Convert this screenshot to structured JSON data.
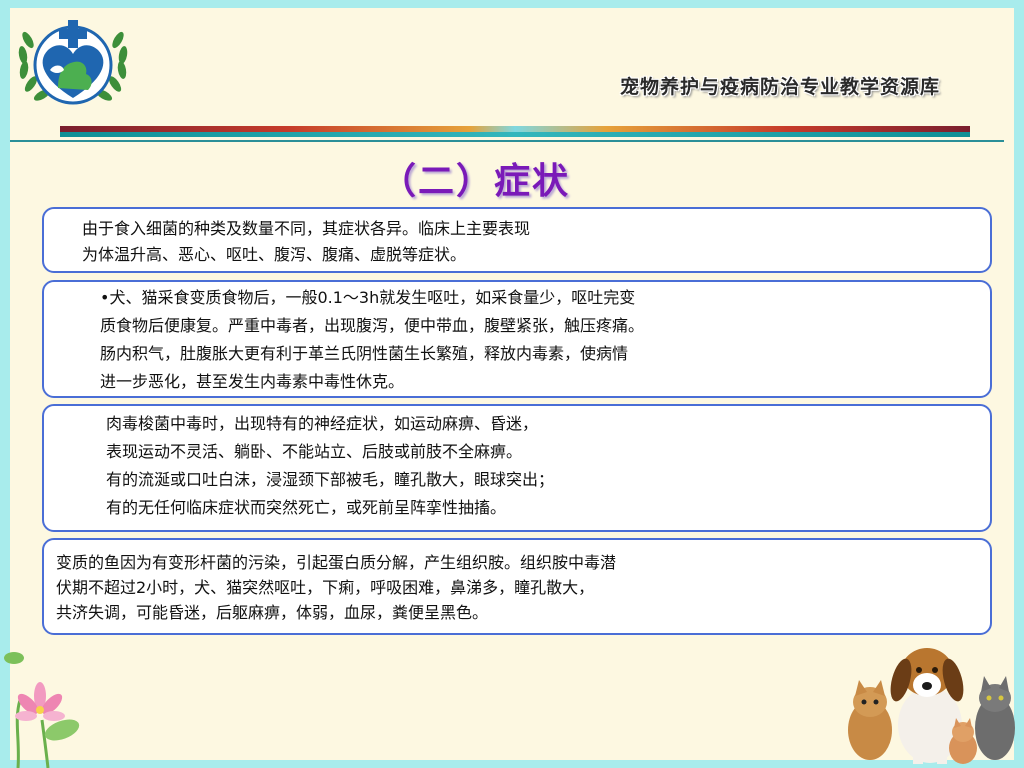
{
  "header": {
    "resource_title": "宠物养护与疫病防治专业教学资源库"
  },
  "slide": {
    "title": "（二）症状",
    "boxes": [
      {
        "lines": [
          "由于食入细菌的种类及数量不同，其症状各异。临床上主要表现",
          "为体温升高、恶心、呕吐、腹泻、腹痛、虚脱等症状。"
        ]
      },
      {
        "lines": [
          "•犬、猫采食变质食物后，一般0.1～3h就发生呕吐，如采食量少，呕吐完变",
          "质食物后便康复。严重中毒者，出现腹泻，便中带血，腹壁紧张，触压疼痛。",
          "肠内积气，肚腹胀大更有利于革兰氏阴性菌生长繁殖，释放内毒素，使病情",
          "进一步恶化，甚至发生内毒素中毒性休克。"
        ]
      },
      {
        "lines": [
          "肉毒梭菌中毒时，出现特有的神经症状，如运动麻痹、昏迷，",
          "表现运动不灵活、躺卧、不能站立、后肢或前肢不全麻痹。",
          "有的流涎或口吐白沫，浸湿颈下部被毛，瞳孔散大，眼球突出；",
          "有的无任何临床症状而突然死亡，或死前呈阵挛性抽搐。"
        ]
      },
      {
        "lines": [
          "变质的鱼因为有变形杆菌的污染，引起蛋白质分解，产生组织胺。组织胺中毒潜",
          "伏期不超过2小时，犬、猫突然呕吐，下痢，呼吸困难，鼻涕多，瞳孔散大，",
          "共济失调，可能昏迷，后躯麻痹，体弱，血尿，粪便呈黑色。"
        ]
      }
    ]
  },
  "colors": {
    "title": "#7a1ab8",
    "box_border": "#4a6ed6",
    "page_background": "#fdf8e1",
    "frame": "#a8ecec"
  },
  "icons": [
    "veterinary-logo",
    "lotus-flower",
    "dog-and-cats-photo"
  ]
}
